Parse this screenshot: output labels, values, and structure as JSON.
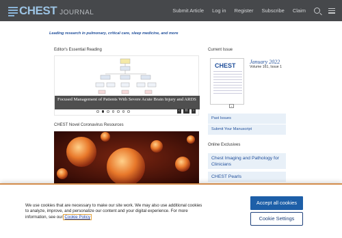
{
  "header": {
    "logo_word": "CHEST",
    "logo_journal": "JOURNAL",
    "nav": [
      "Submit Article",
      "Log in",
      "Register",
      "Subscribe",
      "Claim"
    ]
  },
  "tagline": "Leading research in pulmonary, critical care, sleep medicine, and more",
  "editors_reading": {
    "title": "Editor's Essential Reading",
    "caption": "Focused Management of Patients With Severe Acute Brain Injury and ARDS",
    "pause_symbol": "II",
    "prev_symbol": "‹",
    "next_symbol": "›"
  },
  "covid": {
    "title": "CHEST Novel Coronavirus Resources"
  },
  "current_issue": {
    "title": "Current Issue",
    "cover_title": "CHEST",
    "date": "January 2022",
    "volume": "Volume 161, Issue 1",
    "toggle_symbol": "+"
  },
  "links": {
    "past_issues": "Past Issues",
    "submit_manuscript": "Submit Your Manuscript"
  },
  "online_exclusives": {
    "title": "Online Exclusives",
    "items": [
      "Chest Imaging and Pathology for Clinicians",
      "CHEST Pearls"
    ]
  },
  "cookie": {
    "text": "We use cookies that are necessary to make our site work. We may also use additional cookies to analyze, improve, and personalize our content and your digital experience. For more information, see our",
    "policy_link": "Cookie Policy",
    "accept_label": "Accept all cookies",
    "settings_label": "Cookie Settings"
  },
  "colors": {
    "header_bg": "#46484b",
    "brand_blue": "#1f4e9a",
    "accept_button": "#1d5fa8",
    "banner_border": "#d28b4a"
  }
}
